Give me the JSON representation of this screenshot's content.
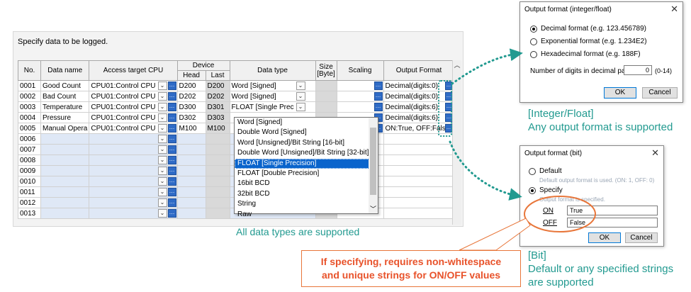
{
  "panel": {
    "title": "Specify data to be logged.",
    "headers": {
      "no": "No.",
      "data_name": "Data name",
      "access": "Access target CPU",
      "device": "Device",
      "head": "Head",
      "last": "Last",
      "data_type": "Data type",
      "size": "Size\n[Byte]",
      "scaling": "Scaling",
      "output_format": "Output Format"
    },
    "rows": [
      {
        "no": "0001",
        "name": "Good Count",
        "cpu": "CPU01:Control CPU",
        "head": "D200",
        "last": "D200",
        "type": "Word [Signed]",
        "fmt": "Decimal(digits:0)"
      },
      {
        "no": "0002",
        "name": "Bad Count",
        "cpu": "CPU01:Control CPU",
        "head": "D202",
        "last": "D202",
        "type": "Word [Signed]",
        "fmt": "Decimal(digits:0)"
      },
      {
        "no": "0003",
        "name": "Temperature",
        "cpu": "CPU01:Control CPU",
        "head": "D300",
        "last": "D301",
        "type": "FLOAT [Single Prec",
        "fmt": "Decimal(digits:6)"
      },
      {
        "no": "0004",
        "name": "Pressure",
        "cpu": "CPU01:Control CPU",
        "head": "D302",
        "last": "D303",
        "type": "",
        "fmt": "Decimal(digits:6)"
      },
      {
        "no": "0005",
        "name": "Manual Opera",
        "cpu": "CPU01:Control CPU",
        "head": "M100",
        "last": "M100",
        "type": "",
        "fmt": "ON:True, OFF:False"
      },
      {
        "no": "0006",
        "name": "",
        "cpu": "",
        "head": "",
        "last": "",
        "type": "",
        "fmt": ""
      },
      {
        "no": "0007",
        "name": "",
        "cpu": "",
        "head": "",
        "last": "",
        "type": "",
        "fmt": ""
      },
      {
        "no": "0008",
        "name": "",
        "cpu": "",
        "head": "",
        "last": "",
        "type": "",
        "fmt": ""
      },
      {
        "no": "0009",
        "name": "",
        "cpu": "",
        "head": "",
        "last": "",
        "type": "",
        "fmt": ""
      },
      {
        "no": "0010",
        "name": "",
        "cpu": "",
        "head": "",
        "last": "",
        "type": "",
        "fmt": ""
      },
      {
        "no": "0011",
        "name": "",
        "cpu": "",
        "head": "",
        "last": "",
        "type": "",
        "fmt": ""
      },
      {
        "no": "0012",
        "name": "",
        "cpu": "",
        "head": "",
        "last": "",
        "type": "",
        "fmt": ""
      },
      {
        "no": "0013",
        "name": "",
        "cpu": "",
        "head": "",
        "last": "",
        "type": "",
        "fmt": ""
      }
    ]
  },
  "dropdown": {
    "items": [
      "Word [Signed]",
      "Double Word [Signed]",
      "Word [Unsigned]/Bit String [16-bit]",
      "Double Word [Unsigned]/Bit String [32-bit]",
      "FLOAT [Single Precision]",
      "FLOAT [Double Precision]",
      "16bit BCD",
      "32bit BCD",
      "String",
      "Raw"
    ],
    "selected_index": 4
  },
  "dialog_float": {
    "title": "Output format (integer/float)",
    "decimal": "Decimal format (e.g. 123.456789)",
    "exponential": "Exponential format (e.g. 1.234E2)",
    "hex": "Hexadecimal format (e.g. 188F)",
    "digits_label": "Number of digits in decimal part",
    "digits_value": "0",
    "digits_range": "(0-14)",
    "ok": "OK",
    "cancel": "Cancel"
  },
  "dialog_bit": {
    "title": "Output format (bit)",
    "default_label": "Default",
    "default_desc": "Default output format is used. (ON: 1, OFF: 0)",
    "specify_label": "Specify",
    "specify_desc": "Output format is specified.",
    "on_label": "ON",
    "on_value": "True",
    "off_label": "OFF",
    "off_value": "False",
    "ok": "OK",
    "cancel": "Cancel"
  },
  "captions": {
    "all_types": "All data types are supported",
    "int_float_title": "[Integer/Float]",
    "int_float_desc": "Any output format is supported",
    "bit_title": "[Bit]",
    "bit_desc1": "Default or any specified strings",
    "bit_desc2": "are supported",
    "callout1": "If specifying, requires non-whitespace",
    "callout2": "and unique strings for ON/OFF values"
  },
  "colors": {
    "teal": "#229a90",
    "orange": "#e8763a",
    "selection": "#0a64cc"
  }
}
